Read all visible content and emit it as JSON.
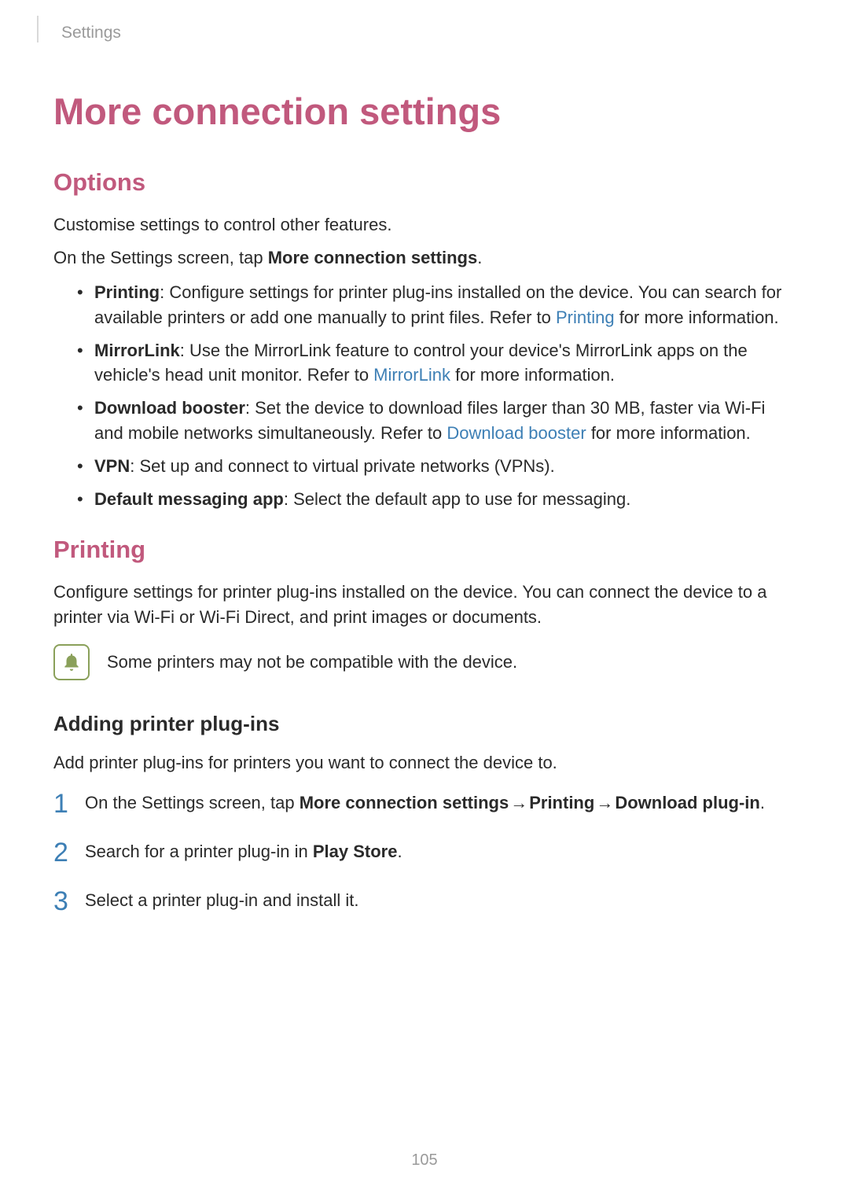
{
  "header": "Settings",
  "title": "More connection settings",
  "options": {
    "heading": "Options",
    "intro1": "Customise settings to control other features.",
    "intro2_prefix": "On the Settings screen, tap ",
    "intro2_bold": "More connection settings",
    "intro2_suffix": ".",
    "items": [
      {
        "name": "Printing",
        "text1": ": Configure settings for printer plug-ins installed on the device. You can search for available printers or add one manually to print files. Refer to ",
        "link": "Printing",
        "text2": " for more information."
      },
      {
        "name": "MirrorLink",
        "text1": ": Use the MirrorLink feature to control your device's MirrorLink apps on the vehicle's head unit monitor. Refer to ",
        "link": "MirrorLink",
        "text2": " for more information."
      },
      {
        "name": "Download booster",
        "text1": ": Set the device to download files larger than 30 MB, faster via Wi-Fi and mobile networks simultaneously. Refer to ",
        "link": "Download booster",
        "text2": " for more information."
      },
      {
        "name": "VPN",
        "text1": ": Set up and connect to virtual private networks (VPNs).",
        "link": "",
        "text2": ""
      },
      {
        "name": "Default messaging app",
        "text1": ": Select the default app to use for messaging.",
        "link": "",
        "text2": ""
      }
    ]
  },
  "printing": {
    "heading": "Printing",
    "intro": "Configure settings for printer plug-ins installed on the device. You can connect the device to a printer via Wi-Fi or Wi-Fi Direct, and print images or documents.",
    "note": "Some printers may not be compatible with the device."
  },
  "adding": {
    "heading": "Adding printer plug-ins",
    "intro": "Add printer plug-ins for printers you want to connect the device to.",
    "steps": [
      {
        "prefix": "On the Settings screen, tap ",
        "bold1": "More connection settings",
        "arrow1": " → ",
        "bold2": "Printing",
        "arrow2": " → ",
        "bold3": "Download plug-in",
        "suffix": "."
      },
      {
        "prefix": "Search for a printer plug-in in ",
        "bold1": "Play Store",
        "suffix": "."
      },
      {
        "prefix": "Select a printer plug-in and install it.",
        "bold1": "",
        "suffix": ""
      }
    ]
  },
  "page_number": "105"
}
